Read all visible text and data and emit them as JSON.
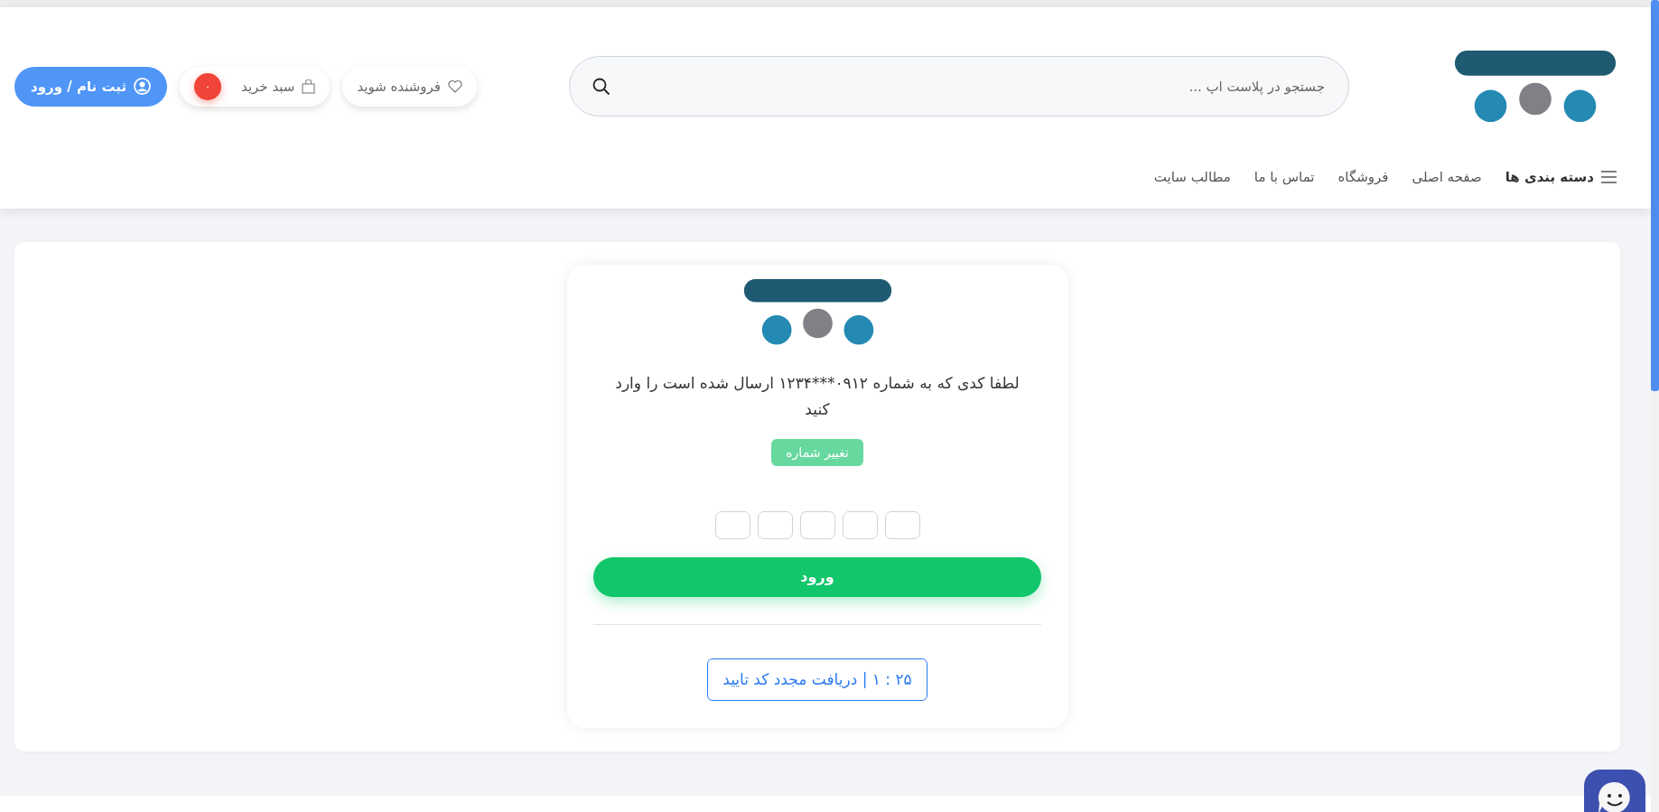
{
  "header": {
    "search": {
      "placeholder": "جستجو در پلاست اپ ..."
    },
    "buttons": [
      {
        "kind": "seller",
        "label": "فروشنده شوید"
      },
      {
        "kind": "cart",
        "label": "سبد خرید",
        "badge": "۰"
      },
      {
        "kind": "login",
        "label": "ثبت نام / ورود"
      }
    ],
    "nav": [
      {
        "kind": "menu",
        "label": "دسته بندی ها"
      },
      {
        "kind": "link",
        "label": "صفحه اصلی"
      },
      {
        "kind": "link",
        "label": "فروشگاه"
      },
      {
        "kind": "link",
        "label": "تماس با ما"
      },
      {
        "kind": "link",
        "label": "مطالب سایت"
      }
    ]
  },
  "login_card": {
    "message": "لطفا کدی که به شماره ۰۹۱۲***۱۲۳۴ ارسال شده است را وارد کنید",
    "change_number": "تغییر شماره",
    "code_boxes": [
      {
        "filled": false
      },
      {
        "filled": false
      },
      {
        "filled": false
      },
      {
        "filled": false
      },
      {
        "filled": false
      }
    ],
    "submit": "ورود",
    "resend": "۲۵ : ۱ | دریافت مجدد کد تایید"
  }
}
